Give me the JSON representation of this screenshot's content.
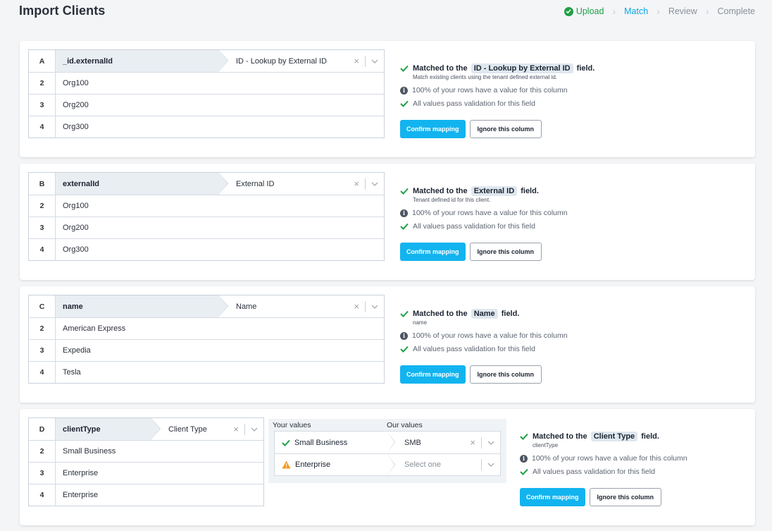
{
  "page": {
    "title": "Import Clients"
  },
  "stepper": {
    "steps": [
      {
        "label": "Upload",
        "state": "done"
      },
      {
        "label": "Match",
        "state": "active"
      },
      {
        "label": "Review",
        "state": "todo"
      },
      {
        "label": "Complete",
        "state": "todo"
      }
    ]
  },
  "colors": {
    "accent": "#12b4ef",
    "success": "#1ea045",
    "warning": "#f29b1d"
  },
  "common": {
    "matched_prefix": "Matched to the",
    "matched_suffix": "field.",
    "rows_stat": "100% of your rows have a value for this column",
    "validation_stat": "All values pass validation for this field",
    "confirm_label": "Confirm mapping",
    "ignore_label": "Ignore this column",
    "your_values_label": "Your values",
    "our_values_label": "Our values"
  },
  "columns": [
    {
      "letter": "A",
      "header": "_id.externalId",
      "field": "ID - Lookup by External ID",
      "rows": [
        {
          "num": "2",
          "value": "Org100"
        },
        {
          "num": "3",
          "value": "Org200"
        },
        {
          "num": "4",
          "value": "Org300"
        }
      ],
      "description": "Match existing clients using the tenant defined external id."
    },
    {
      "letter": "B",
      "header": "externalId",
      "field": "External ID",
      "rows": [
        {
          "num": "2",
          "value": "Org100"
        },
        {
          "num": "3",
          "value": "Org200"
        },
        {
          "num": "4",
          "value": "Org300"
        }
      ],
      "description": "Tenant defined id for this client."
    },
    {
      "letter": "C",
      "header": "name",
      "field": "Name",
      "rows": [
        {
          "num": "2",
          "value": "American Express"
        },
        {
          "num": "3",
          "value": "Expedia"
        },
        {
          "num": "4",
          "value": "Tesla"
        }
      ],
      "description": "name"
    },
    {
      "letter": "D",
      "header": "clientType",
      "field": "Client Type",
      "rows": [
        {
          "num": "2",
          "value": "Small Business"
        },
        {
          "num": "3",
          "value": "Enterprise"
        },
        {
          "num": "4",
          "value": "Enterprise"
        }
      ],
      "description": "clientType",
      "value_mapping": [
        {
          "yours": "Small Business",
          "status": "check-icon",
          "ours": "SMB",
          "has_value": true
        },
        {
          "yours": "Enterprise",
          "status": "warning-icon",
          "ours": "Select one",
          "has_value": false
        }
      ]
    }
  ]
}
